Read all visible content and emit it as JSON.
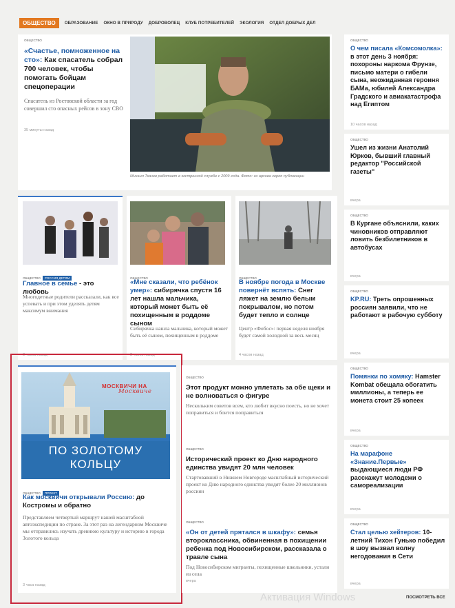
{
  "nav": {
    "rubric": "ОБЩЕСТВО",
    "links": [
      "ОБРАЗОВАНИЕ",
      "ОКНО В ПРИРОДУ",
      "ДОБРОВОЛЕЦ",
      "КЛУБ ПОТРЕБИТЕЛЕЙ",
      "ЭКОЛОГИЯ",
      "ОТДЕЛ ДОБРЫХ ДЕЛ"
    ]
  },
  "main_story": {
    "tag": "ОБЩЕСТВО",
    "title_highlight": "«Счастье, помноженное на сто»:",
    "title_rest": " Как спасатель собрал 700 человек, чтобы помогать бойцам спецоперации",
    "lead": "Спасатель из Ростовской области за год совершил сто опасных рейсов в зону СВО",
    "time": "35 минуты назад",
    "photo_caption": "Михаил Ткачев работает в экстренной службе с 2009 года. Фото: из архива героя публикации"
  },
  "mid_cards": [
    {
      "tags": [
        "ОБЩЕСТВО",
        "РОССИЯ ДЕТЯМ"
      ],
      "title_highlight": "Главное в семье",
      "title_rest": " - это любовь",
      "lead": "Многодетные родители рассказали, как все успевать и при этом уделять детям максимум внимания",
      "time": "3 часов назад"
    },
    {
      "tags": [
        "ОБЩЕСТВО"
      ],
      "title_highlight": "«Мне сказали, что ребёнок умер»:",
      "title_rest": " сибирячка спустя 16 лет нашла мальчика, который может быть её похищенным в роддоме сыном",
      "lead": "Сибирячка нашла мальчика, который может быть её сыном, похищенным в роддоме",
      "time": "3 часов назад"
    },
    {
      "tags": [
        "ОБЩЕСТВО"
      ],
      "title_highlight": "В ноябре погода в Москве повернёт вспять:",
      "title_rest": " Снег ляжет на землю белым покрывалом, но потом будет тепло и солнце",
      "lead": "Центр «Фобос»: первая неделя ноября будет самой холодной за весь месяц",
      "time": "4 часов назад"
    }
  ],
  "promo": {
    "banner_brand": "МОСКВИЧИ НА",
    "banner_brand_script": "Москвиче",
    "banner_line1": "ПО ЗОЛОТОМУ",
    "banner_line2": "КОЛЬЦУ",
    "tags": [
      "ОБЩЕСТВО",
      "ПРОЕКТ"
    ],
    "title_highlight": "Как москвичи открывали Россию:",
    "title_rest": " до Костромы и обратно",
    "lead": "Представляем четвертый маршрут нашей масштабной автоэкспедиции по стране. За этот раз на легендарном Москвиче мы отправились изучать древнюю культуру и историю в города Золотого кольца",
    "time": "3 часа назад"
  },
  "list": [
    {
      "tag": "ОБЩЕСТВО",
      "title": "Этот продукт можно уплетать за обе щеки и не волноваться о фигуре",
      "lead": "Нескольким советов всем, кто любит вкусно поесть, но не хочет поправиться и боится поправиться"
    },
    {
      "tag": "ОБЩЕСТВО",
      "title": "Исторический проект ко Дню народного единства увидят 20 млн человек",
      "lead": "Стартовавший в Нижнем Новгороде масштабный исторический проект ко Дню народного единства увидят более 20 миллионов россиян"
    },
    {
      "tag": "ОБЩЕСТВО",
      "title_highlight": "«Он от детей прятался в шкафу»:",
      "title_rest": " семья второклассника, обвиненная в похищении ребенка под Новосибирском, рассказала о травле сына",
      "lead": "Под Новосибирском мигранты, похищенные школьники, устали из села",
      "time": "вчера"
    }
  ],
  "right_column": [
    {
      "tag": "ОБЩЕСТВО",
      "title_highlight": "О чем писала «Комсомолка»:",
      "title_rest": " в этот день 3 ноября: похороны наркома Фрунзе, письмо матери о гибели сына, неожиданная героиня БАМа, юбилей Александра Градского и авиакатастрофа над Египтом",
      "time": "10 часов назад"
    },
    {
      "tag": "ОБЩЕСТВО",
      "title_highlight": "",
      "title_rest": "Ушел из жизни Анатолий Юрков, бывший главный редактор \"Российской газеты\"",
      "time": "вчера"
    },
    {
      "tag": "ОБЩЕСТВО",
      "title_highlight": "",
      "title_rest": "В Кургане объяснили, каких чиновников отправляют ловить безбилетников в автобусах",
      "time": "вчера"
    },
    {
      "tag": "ОБЩЕСТВО",
      "title_highlight": "KP.RU:",
      "title_rest": " Треть опрошенных россиян заявили, что не работают в рабочую субботу",
      "time": "вчера"
    },
    {
      "tag": "ОБЩЕСТВО",
      "title_highlight": "Помянки по хомяку:",
      "title_rest": " Hamster Kombat обещала обогатить миллионы, а теперь ее монета стоит 25 копеек",
      "time": "вчера"
    },
    {
      "tag": "ОБЩЕСТВО",
      "title_highlight": "На марафоне «Знание.Первые»",
      "title_rest": " выдающиеся люди РФ расскажут молодежи о самореализации",
      "time": "вчера"
    },
    {
      "tag": "ОБЩЕСТВО",
      "title_highlight": "Стал целью хейтеров:",
      "title_rest": " 10-летний Тихон Гунько победил в шоу вызвал волну негодования в Сети",
      "time": "вчера"
    }
  ],
  "footer": {
    "more": "ПОСМОТРЕТЬ ВСЕ",
    "watermark": "Активация Windows"
  }
}
